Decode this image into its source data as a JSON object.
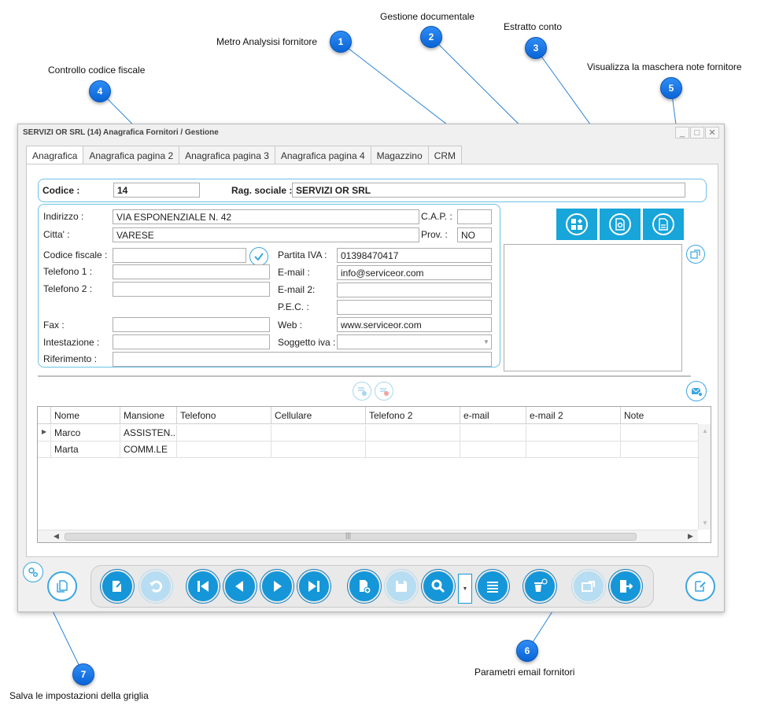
{
  "callouts": [
    {
      "num": "1",
      "label": "Metro Analysisi fornitore"
    },
    {
      "num": "2",
      "label": "Gestione documentale"
    },
    {
      "num": "3",
      "label": "Estratto conto"
    },
    {
      "num": "4",
      "label": "Controllo codice fiscale"
    },
    {
      "num": "5",
      "label": "Visualizza la maschera note fornitore"
    },
    {
      "num": "6",
      "label": "Parametri email fornitori"
    },
    {
      "num": "7",
      "label": "Salva le impostazioni della griglia"
    }
  ],
  "window": {
    "title": "SERVIZI OR SRL (14) Anagrafica Fornitori / Gestione",
    "controls": {
      "minimize": "_",
      "maximize": "□",
      "close": "✕"
    }
  },
  "tabs": [
    "Anagrafica",
    "Anagrafica pagina 2",
    "Anagrafica pagina 3",
    "Anagrafica pagina 4",
    "Magazzino",
    "CRM"
  ],
  "form": {
    "codice_label": "Codice :",
    "codice": "14",
    "rag_sociale_label": "Rag. sociale :",
    "rag_sociale": "SERVIZI OR SRL",
    "indirizzo_label": "Indirizzo :",
    "indirizzo": "VIA ESPONENZIALE N. 42",
    "cap_label": "C.A.P. :",
    "cap": "",
    "citta_label": "Citta' :",
    "citta": "VARESE",
    "prov_label": "Prov. :",
    "prov": "NO",
    "codice_fiscale_label": "Codice fiscale :",
    "codice_fiscale": "",
    "partita_iva_label": "Partita IVA :",
    "partita_iva": "01398470417",
    "telefono1_label": "Telefono 1 :",
    "telefono1": "",
    "email_label": "E-mail :",
    "email": "info@serviceor.com",
    "telefono2_label": "Telefono 2 :",
    "telefono2": "",
    "email2_label": "E-mail 2:",
    "email2": "",
    "pec_label": "P.E.C. :",
    "pec": "",
    "fax_label": "Fax :",
    "fax": "",
    "web_label": "Web :",
    "web": "www.serviceor.com",
    "intestazione_label": "Intestazione :",
    "intestazione": "",
    "soggetto_iva_label": "Soggetto iva :",
    "soggetto_iva": "",
    "riferimento_label": "Riferimento :",
    "riferimento": ""
  },
  "grid": {
    "columns": [
      "Nome",
      "Mansione",
      "Telefono",
      "Cellulare",
      "Telefono 2",
      "e-mail",
      "e-mail 2",
      "Note"
    ],
    "rows": [
      [
        "Marco",
        "ASSISTEN...",
        "",
        "",
        "",
        "",
        "",
        ""
      ],
      [
        "Marta",
        "COMM.LE",
        "",
        "",
        "",
        "",
        "",
        ""
      ]
    ],
    "scroll_grip": "|||"
  },
  "colors": {
    "accent": "#17a5da",
    "badge": "#1a7ee8",
    "button": "#1596d8"
  }
}
